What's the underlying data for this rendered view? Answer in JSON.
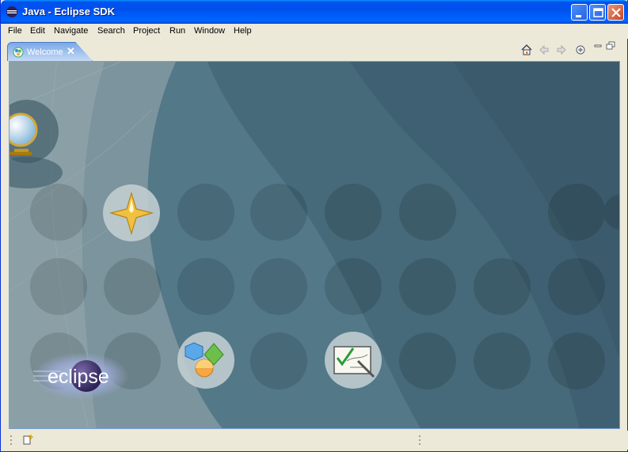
{
  "window": {
    "title": "Java - Eclipse SDK",
    "controls": [
      "minimize",
      "maximize",
      "close"
    ]
  },
  "menubar": {
    "items": [
      "File",
      "Edit",
      "Navigate",
      "Search",
      "Project",
      "Run",
      "Window",
      "Help"
    ]
  },
  "editor_tab": {
    "label": "Welcome",
    "close_glyph": "✕"
  },
  "welcome_toolbar": {
    "icons": [
      "home-icon",
      "back-icon",
      "forward-icon",
      "customize-icon",
      "minimize-icon",
      "restore-icon"
    ]
  },
  "welcome": {
    "logo_text": "eclipse",
    "links": [
      "overview-icon",
      "whats-new-icon",
      "samples-icon",
      "tutorials-icon"
    ]
  },
  "colors": {
    "title_blue": "#0054e3",
    "background_teal": "#4d7181",
    "accent_gold": "#f0c040"
  }
}
